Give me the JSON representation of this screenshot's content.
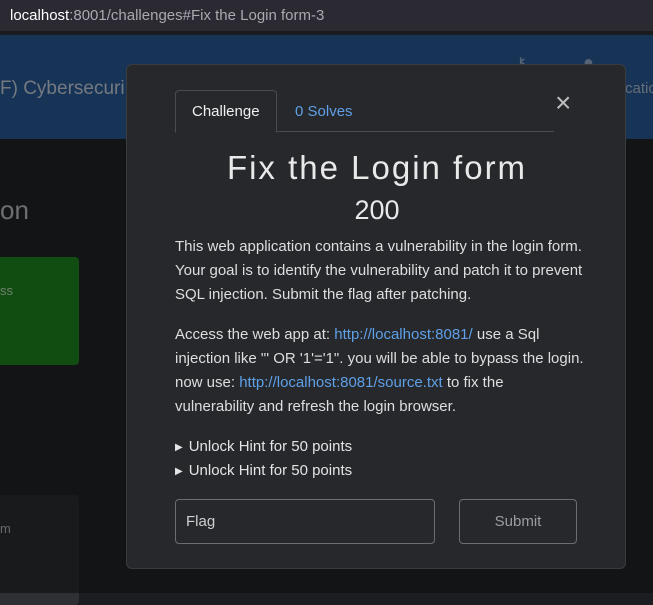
{
  "browser": {
    "url_host": "localhost",
    "url_rest": ":8001/challenges#Fix the Login form-3"
  },
  "background": {
    "brand": "F) Cybersecuri",
    "nav_right": "catio",
    "section_title": "on",
    "card_green_text": "ss",
    "card_dark_text": "m"
  },
  "modal": {
    "tabs": [
      {
        "label": "Challenge"
      },
      {
        "label": "0 Solves"
      }
    ],
    "close_glyph": "×",
    "title": "Fix the Login form",
    "value": "200",
    "description_1": "This web application contains a vulnerability in the login form. Your goal is to identify the vulnerability and patch it to prevent SQL injection. Submit the flag after patching.",
    "description_2": {
      "part_1": "Access the web app at: ",
      "link_1": "http://localhost:8081/",
      "part_2": " use a Sql injection like \"' OR '1'='1\". you will be able to bypass the login. now use: ",
      "link_2": "http://localhost:8081/source.txt",
      "part_3": " to fix the vulnerability and refresh the login browser."
    },
    "hints": [
      {
        "label": "Unlock Hint for 50 points"
      },
      {
        "label": "Unlock Hint for 50 points"
      }
    ],
    "flag_placeholder": "Flag",
    "submit_label": "Submit"
  },
  "colors": {
    "link": "#5fa0e6",
    "navbar": "#2a5f9e",
    "green_card": "#1f8a1f"
  }
}
